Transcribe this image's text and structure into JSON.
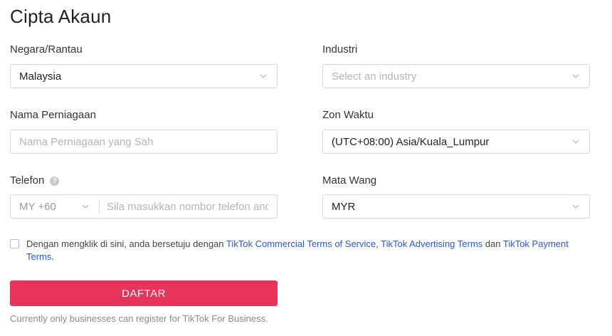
{
  "page": {
    "title": "Cipta Akaun"
  },
  "form": {
    "country": {
      "label": "Negara/Rantau",
      "value": "Malaysia"
    },
    "industry": {
      "label": "Industri",
      "placeholder": "Select an industry"
    },
    "business_name": {
      "label": "Nama Perniagaan",
      "placeholder": "Nama Perniagaan yang Sah"
    },
    "timezone": {
      "label": "Zon Waktu",
      "value": "(UTC+08:00) Asia/Kuala_Lumpur"
    },
    "phone": {
      "label": "Telefon",
      "help_icon": "?",
      "country_code": "MY +60",
      "placeholder": "Sila masukkan nombor  telefon anda"
    },
    "currency": {
      "label": "Mata Wang",
      "value": "MYR"
    }
  },
  "consent": {
    "prefix": "Dengan mengklik di sini, anda bersetuju dengan ",
    "link1": "TikTok Commercial Terms of Service",
    "sep1": ", ",
    "link2": "TikTok Advertising Terms",
    "sep2": " dan ",
    "link3": "TikTok Payment Terms",
    "suffix": "."
  },
  "submit_label": "DAFTAR",
  "footnote": "Currently only businesses can register for TikTok For Business.",
  "colors": {
    "primary": "#e8335a",
    "link": "#2f57d6",
    "border": "#d9d9d9",
    "placeholder": "#b5b5b5"
  },
  "icons": {
    "select_arrow": "chevron-down-icon",
    "help": "help-icon"
  }
}
